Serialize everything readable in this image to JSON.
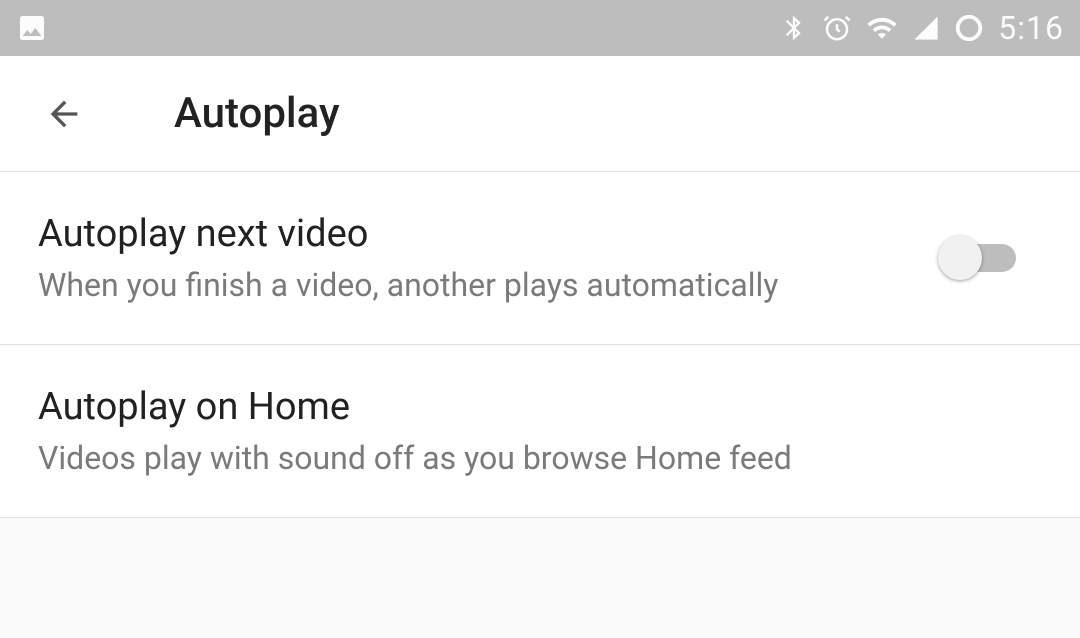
{
  "status_bar": {
    "time": "5:16"
  },
  "header": {
    "title": "Autoplay"
  },
  "settings": [
    {
      "title": "Autoplay next video",
      "subtitle": "When you finish a video, another plays automatically",
      "toggle_state": "off"
    },
    {
      "title": "Autoplay on Home",
      "subtitle": "Videos play with sound off as you browse Home feed"
    }
  ]
}
